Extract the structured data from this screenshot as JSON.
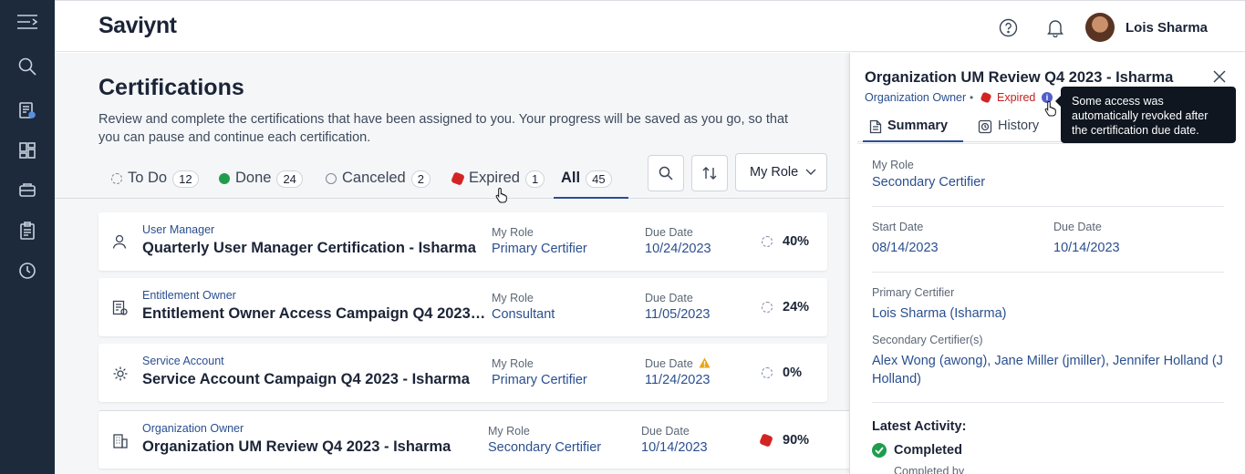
{
  "app": {
    "logo": "Saviynt",
    "user_name": "Lois Sharma"
  },
  "nav_icons": [
    "menu-icon",
    "search-icon",
    "certification-icon",
    "dashboard-icon",
    "request-icon",
    "clipboard-icon",
    "history-icon"
  ],
  "page": {
    "title": "Certifications",
    "description": "Review and complete the certifications that have been assigned to you. Your progress will be saved as you go, so that you can pause and continue each certification."
  },
  "tabs": [
    {
      "label": "To Do",
      "count": "12"
    },
    {
      "label": "Done",
      "count": "24"
    },
    {
      "label": "Canceled",
      "count": "2"
    },
    {
      "label": "Expired",
      "count": "1"
    },
    {
      "label": "All",
      "count": "45"
    }
  ],
  "toolbar": {
    "role_filter": "My Role"
  },
  "labels": {
    "my_role": "My Role",
    "due_date": "Due Date"
  },
  "certifications": [
    {
      "type": "User Manager",
      "name": "Quarterly User Manager Certification - Isharma",
      "role": "Primary Certifier",
      "due": "10/24/2023",
      "progress": "40%",
      "status": "in-progress"
    },
    {
      "type": "Entitlement Owner",
      "name": "Entitlement Owner Access Campaign Q4 2023 -...",
      "role": "Consultant",
      "due": "11/05/2023",
      "progress": "24%",
      "status": "in-progress"
    },
    {
      "type": "Service Account",
      "name": "Service Account Campaign Q4 2023 - Isharma",
      "role": "Primary Certifier",
      "due": "11/24/2023",
      "progress": "0%",
      "status": "in-progress",
      "warning": true
    },
    {
      "type": "Organization Owner",
      "name": "Organization UM Review Q4 2023 - Isharma",
      "role": "Secondary Certifier",
      "due": "10/14/2023",
      "progress": "90%",
      "status": "expired"
    }
  ],
  "panel": {
    "title": "Organization UM Review Q4 2023 - Isharma",
    "owner": "Organization Owner",
    "status": "Expired",
    "tabs": [
      "Summary",
      "History"
    ],
    "my_role_label": "My Role",
    "my_role": "Secondary Certifier",
    "start_label": "Start Date",
    "start": "08/14/2023",
    "due_label": "Due Date",
    "due": "10/14/2023",
    "primary_label": "Primary Certifier",
    "primary": "Lois Sharma (Isharma)",
    "secondary_label": "Secondary Certifier(s)",
    "secondary": "Alex Wong (awong), Jane Miller (jmiller), Jennifer Holland (J Holland)",
    "activity_title": "Latest Activity:",
    "activity_status": "Completed",
    "activity_by": "Completed by"
  },
  "tooltip": "Some access was automatically revoked after the certification due date.",
  "colors": {
    "rail": "#1c2a3c",
    "accent": "#2a4f8f",
    "expired": "#d32424",
    "done": "#1f9d4c"
  }
}
